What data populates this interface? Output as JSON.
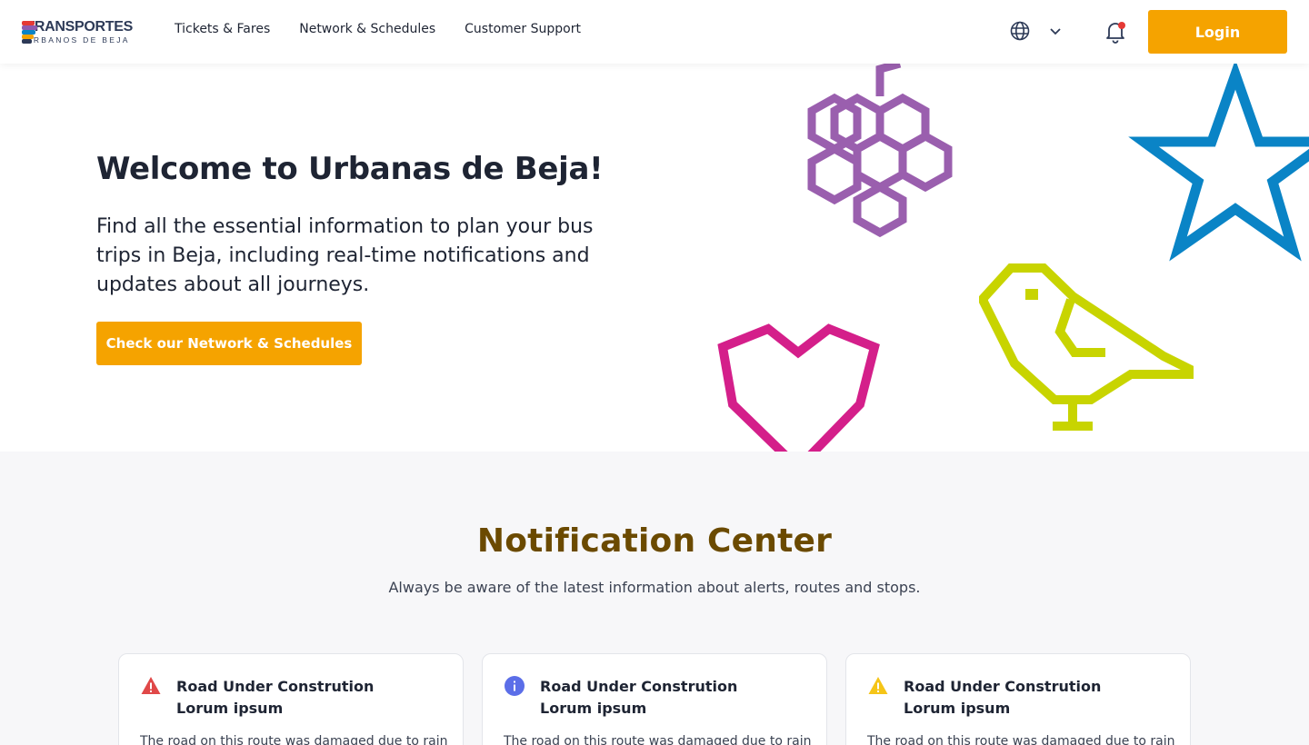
{
  "brand": {
    "logo_top": "TRANSPORTES",
    "logo_bottom": "URBANOS DE BEJA",
    "logo_colors": [
      "#e53935",
      "#f5a300",
      "#8e5bb0",
      "#0a84c6",
      "#2d3a57"
    ]
  },
  "nav": {
    "items": [
      {
        "label": "Tickets & Fares"
      },
      {
        "label": "Network & Schedules"
      },
      {
        "label": "Customer Support"
      }
    ],
    "language_icon": "globe-icon",
    "language_chevron": "chevron-down-icon",
    "notifications_icon": "bell-icon",
    "login_label": "Login"
  },
  "hero": {
    "title": "Welcome to Urbanas de Beja!",
    "subtitle": "Find all the essential information to plan your bus trips in Beja, including real-time notifications and updates about all journeys.",
    "cta_label": "Check our Network & Schedules",
    "decor_colors": {
      "grapes": "#9a5fae",
      "star": "#0a84c6",
      "heart": "#d41f8a",
      "bird": "#c8d400"
    }
  },
  "notification_center": {
    "title": "Notification Center",
    "subtitle": "Always be aware of the latest information about alerts, routes and stops.",
    "cards": [
      {
        "type": "alert",
        "icon": "alert-triangle-icon",
        "color": "#e04848",
        "title": "Road Under Constrution Lorum ipsum",
        "text": "The road on this route was damaged due to rain"
      },
      {
        "type": "info",
        "icon": "info-circle-icon",
        "color": "#5b6ee8",
        "title": "Road Under Constrution Lorum ipsum",
        "text": "The road on this route was damaged due to rain"
      },
      {
        "type": "warning",
        "icon": "warning-triangle-icon",
        "color": "#f5c518",
        "title": "Road Under Constrution Lorum ipsum",
        "text": "The road on this route was damaged due to rain"
      }
    ]
  },
  "colors": {
    "accent": "#f5a300",
    "section_title": "#6b4a00",
    "text": "#1e2433"
  }
}
